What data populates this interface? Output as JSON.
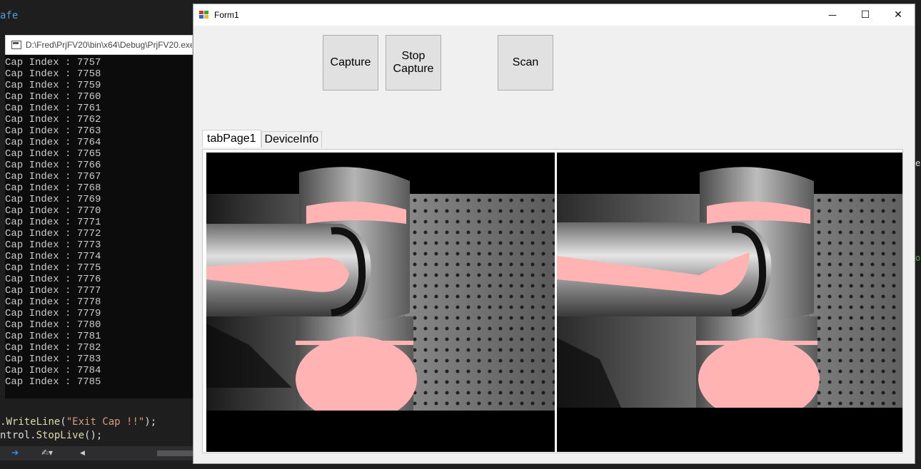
{
  "ide": {
    "top_code_fragment": "afe",
    "code_line_1": {
      "prefix": ".",
      "method": "WriteLine",
      "open": "(",
      "string": "\"Exit Cap !!\"",
      "close": ");"
    },
    "code_line_2": {
      "prefix": "ntrol.",
      "method": "StopLive",
      "close": "();"
    },
    "right_fragment_1": "e)",
    "right_fragment_2": "ot",
    "bottom_bar": {
      "arrow": "➔",
      "tool": "✍▾",
      "left_arrow": "◀"
    }
  },
  "console": {
    "title": "D:\\Fred\\PrjFV20\\bin\\x64\\Debug\\PrjFV20.exe",
    "lines": [
      "Cap Index : 7757",
      "Cap Index : 7758",
      "Cap Index : 7759",
      "Cap Index : 7760",
      "Cap Index : 7761",
      "Cap Index : 7762",
      "Cap Index : 7763",
      "Cap Index : 7764",
      "Cap Index : 7765",
      "Cap Index : 7766",
      "Cap Index : 7767",
      "Cap Index : 7768",
      "Cap Index : 7769",
      "Cap Index : 7770",
      "Cap Index : 7771",
      "Cap Index : 7772",
      "Cap Index : 7773",
      "Cap Index : 7774",
      "Cap Index : 7775",
      "Cap Index : 7776",
      "Cap Index : 7777",
      "Cap Index : 7778",
      "Cap Index : 7779",
      "Cap Index : 7780",
      "Cap Index : 7781",
      "Cap Index : 7782",
      "Cap Index : 7783",
      "Cap Index : 7784",
      "Cap Index : 7785"
    ]
  },
  "form": {
    "title": "Form1",
    "window_controls": {
      "minimize": "—",
      "maximize": "☐",
      "close": "✕"
    },
    "buttons": {
      "capture": "Capture",
      "stop_capture_line1": "Stop",
      "stop_capture_line2": "Capture",
      "scan": "Scan"
    },
    "tabs": [
      {
        "label": "tabPage1",
        "active": true
      },
      {
        "label": "DeviceInfo",
        "active": false
      }
    ]
  },
  "colors": {
    "highlight": "#ffb3b3",
    "form_bg": "#f0f0f0",
    "button_bg": "#e1e1e1",
    "console_bg": "#0c0c0c",
    "console_text": "#cccccc"
  }
}
